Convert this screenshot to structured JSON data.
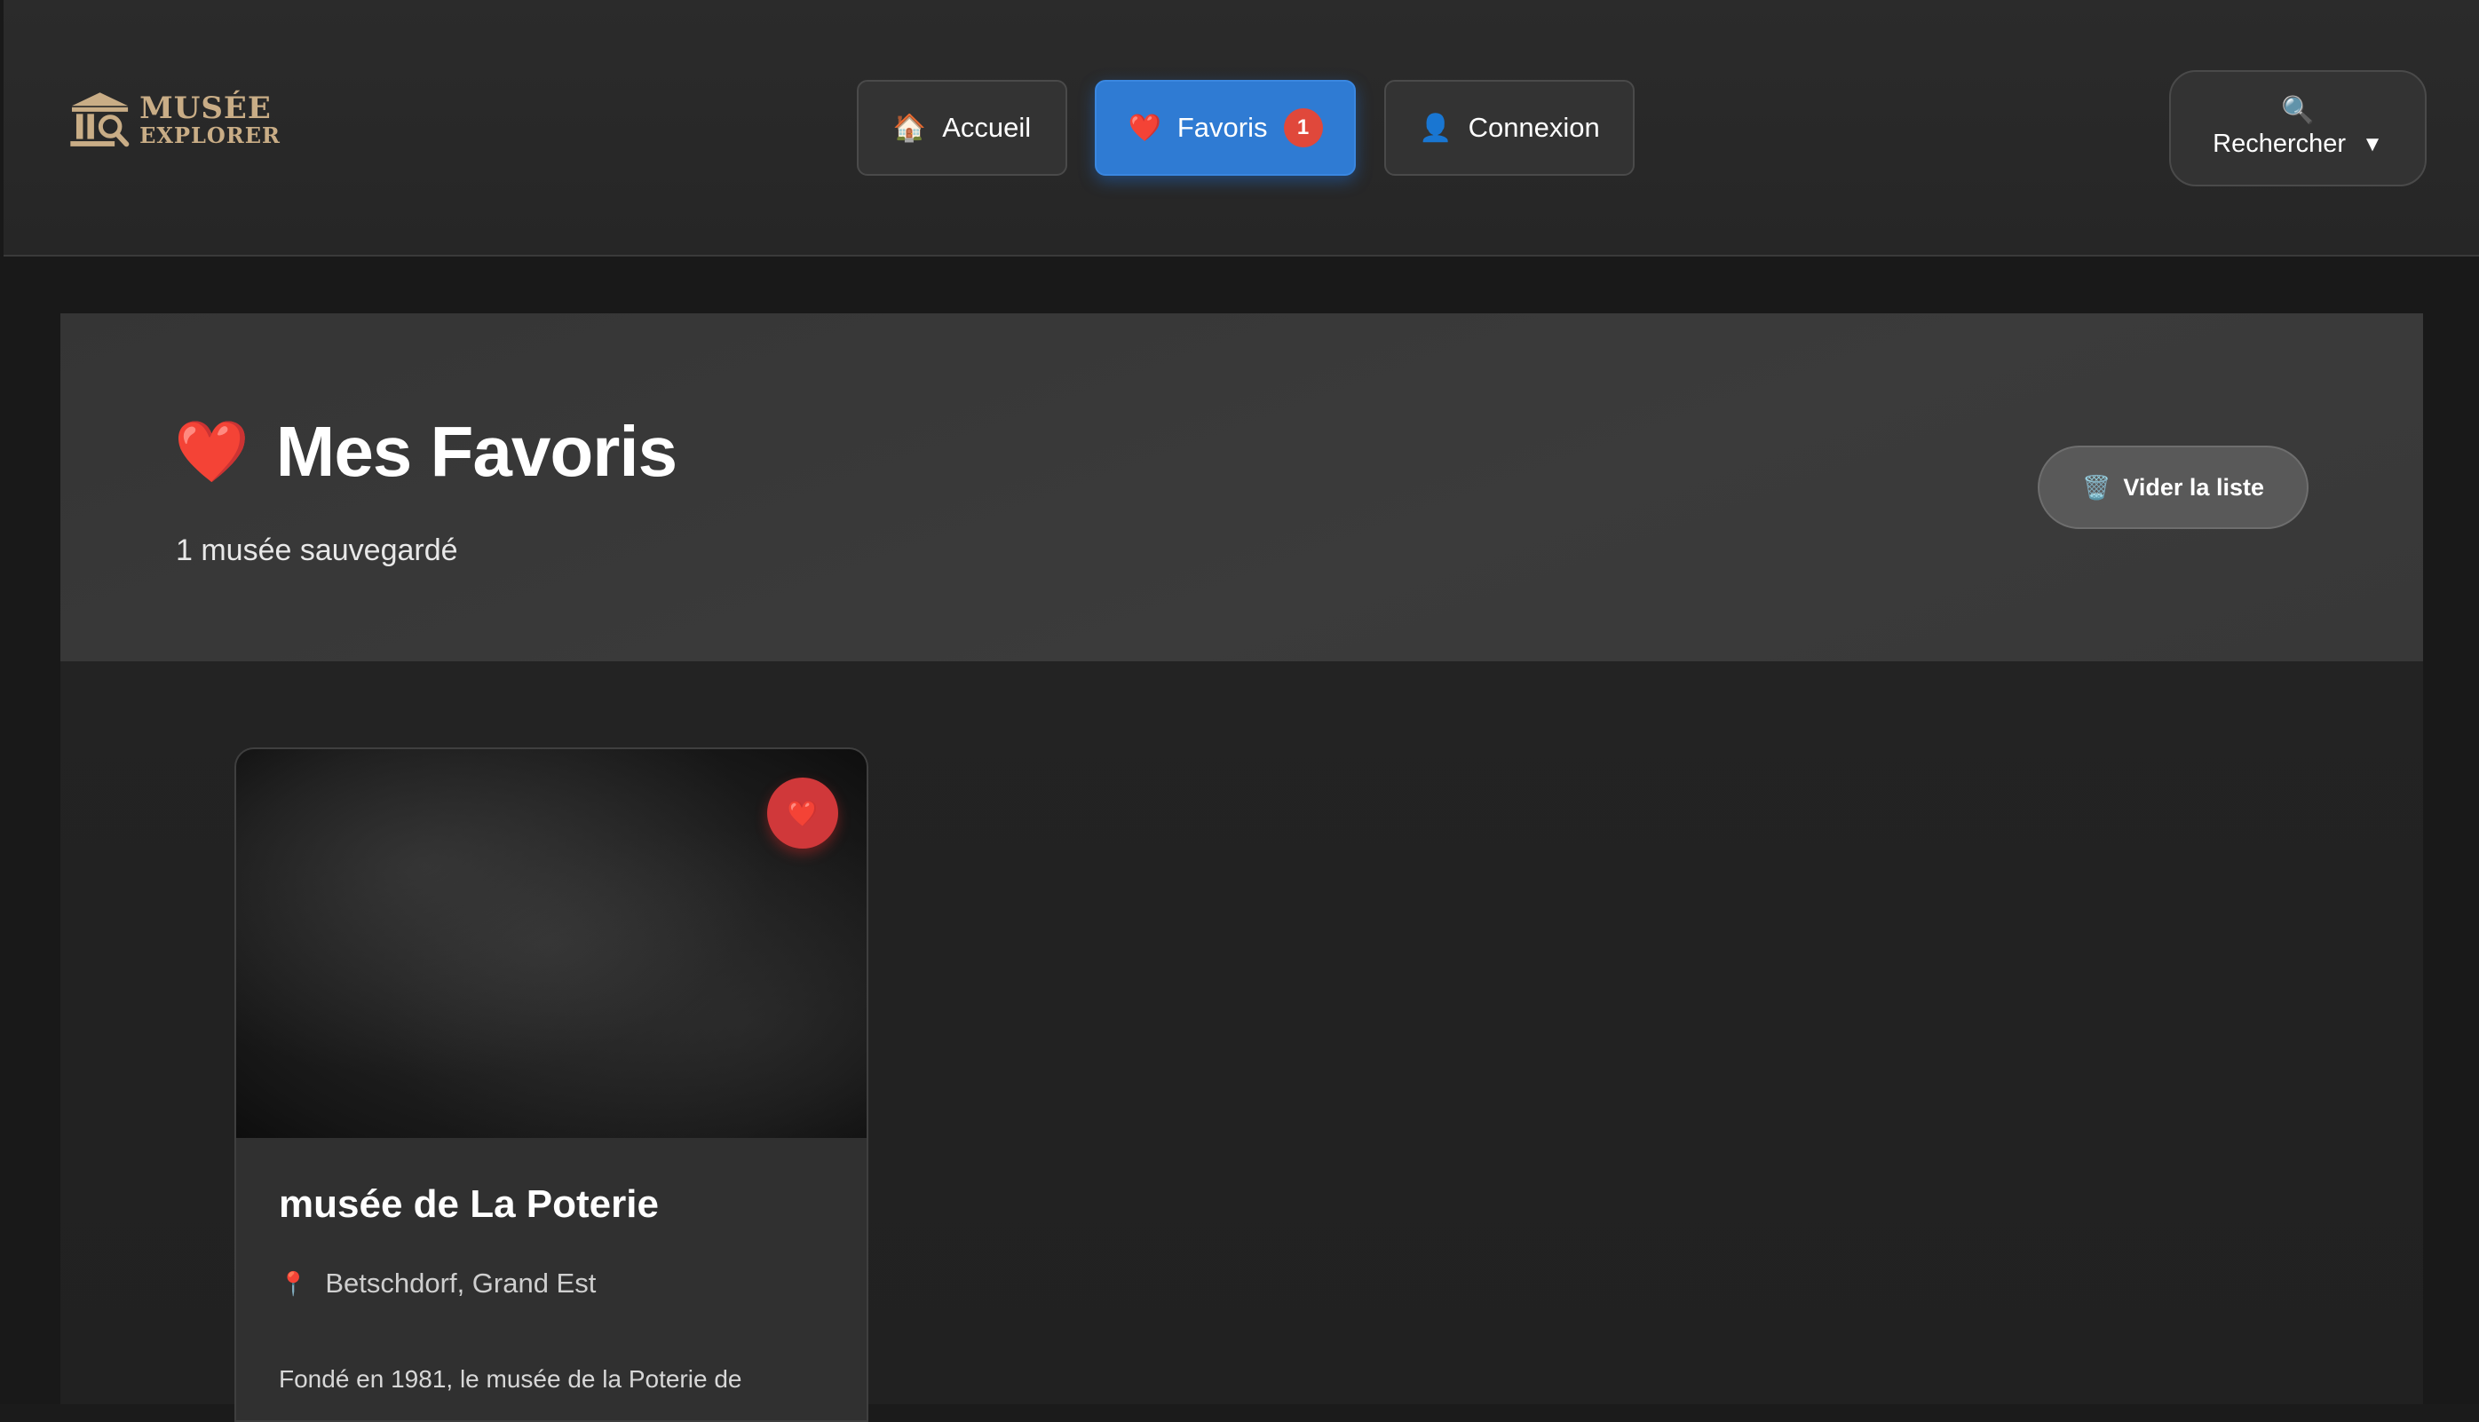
{
  "header": {
    "logo": {
      "line1": "MUSÉE",
      "line2": "EXPLORER",
      "color": "#c9ad86"
    },
    "nav": [
      {
        "label": "Accueil",
        "icon": "house-icon"
      },
      {
        "label": "Favoris",
        "icon": "heart-icon",
        "badge": "1",
        "active": true
      },
      {
        "label": "Connexion",
        "icon": "user-icon"
      }
    ],
    "search": {
      "label": "Rechercher",
      "icon": "magnifier-icon",
      "caret": "▼"
    }
  },
  "hero": {
    "title": "Mes Favoris",
    "title_icon": "heart-icon",
    "subtitle": "1 musée sauvegardé",
    "clear_label": "Vider la liste",
    "clear_icon": "trash-icon"
  },
  "cards": [
    {
      "title": "musée de La Poterie",
      "location": "Betschdorf, Grand Est",
      "description": "Fondé en 1981, le musée de la Poterie de",
      "favorited": true
    }
  ],
  "colors": {
    "accent": "#2f7bd3",
    "badge": "#e0483b",
    "favorite": "#d0383a",
    "background": "#191919"
  }
}
